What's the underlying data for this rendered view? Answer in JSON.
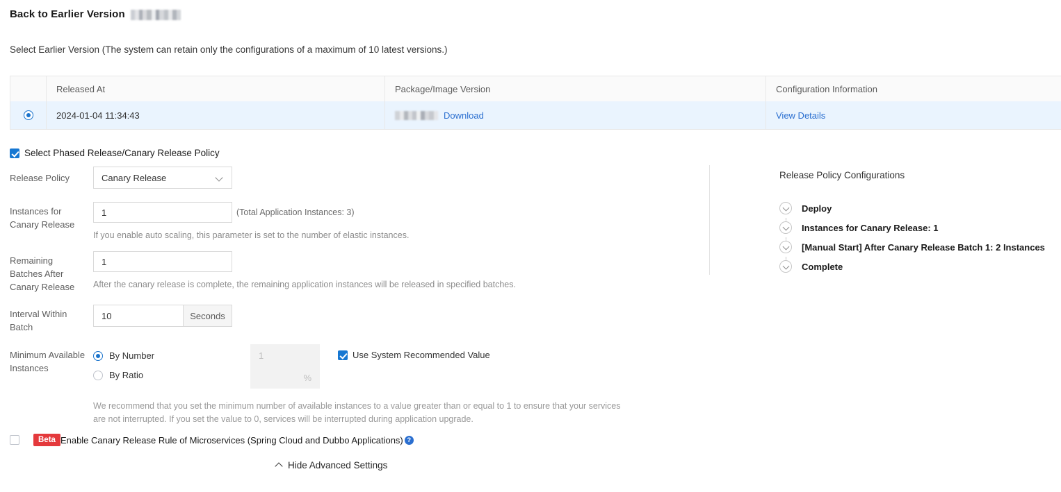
{
  "header": {
    "title": "Back to Earlier Version",
    "masked_app_name": "",
    "subtitle": "Select Earlier Version (The system can retain only the configurations of a maximum of 10 latest versions.)"
  },
  "version_table": {
    "columns": [
      "",
      "Released At",
      "Package/Image Version",
      "Configuration Information"
    ],
    "rows": [
      {
        "selected": true,
        "released_at": "2024-01-04 11:34:43",
        "package_version_masked": "",
        "download_label": "Download",
        "config_link_label": "View Details"
      }
    ]
  },
  "policy_checkbox": {
    "label": "Select Phased Release/Canary Release Policy",
    "checked": true
  },
  "form": {
    "release_policy": {
      "label": "Release Policy",
      "value": "Canary Release",
      "options": [
        "Canary Release"
      ]
    },
    "canary_instances": {
      "label": "Instances for Canary Release",
      "value": "1",
      "note": "(Total Application Instances: 3)",
      "hint": "If you enable auto scaling, this parameter is set to the number of elastic instances."
    },
    "remaining_batches": {
      "label": "Remaining Batches After Canary Release",
      "value": "1",
      "hint": "After the canary release is complete, the remaining application instances will be released in specified batches."
    },
    "interval_within_batch": {
      "label": "Interval Within Batch",
      "value": "10",
      "unit": "Seconds"
    },
    "minimum_available_instances": {
      "label": "Minimum Available Instances",
      "options": [
        {
          "label": "By Number",
          "selected": true
        },
        {
          "label": "By Ratio",
          "selected": false
        }
      ],
      "number_value": "1",
      "ratio_suffix": "%",
      "system_recommended": {
        "label": "Use System Recommended Value",
        "checked": true
      },
      "recommendation": "We recommend that you set the minimum number of available instances to a value greater than or equal to 1 to ensure that your services are not interrupted. If you set the value to 0, services will be interrupted during application upgrade."
    }
  },
  "beta_row": {
    "checked": false,
    "badge": "Beta",
    "label": "Enable Canary Release Rule of Microservices (Spring Cloud and Dubbo Applications)",
    "help": "?"
  },
  "hide_advanced": {
    "label": "Hide Advanced Settings"
  },
  "right_panel": {
    "title": "Release Policy Configurations",
    "steps": [
      {
        "label": "Deploy"
      },
      {
        "label": "Instances for Canary Release: 1"
      },
      {
        "label": "[Manual Start] After Canary Release Batch 1: 2 Instances"
      },
      {
        "label": "Complete"
      }
    ]
  },
  "colors": {
    "accent": "#1677d2",
    "link": "#2b6fd0",
    "row_highlight": "#eaf4fe",
    "beta_badge": "#e4393c"
  }
}
